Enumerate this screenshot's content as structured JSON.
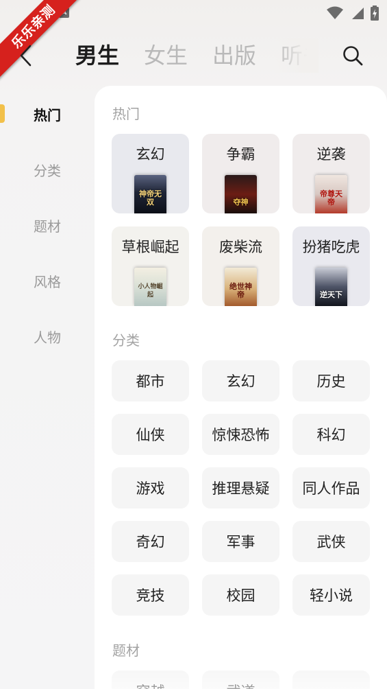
{
  "status": {
    "badge": "A"
  },
  "ribbon": {
    "text": "乐乐亲测"
  },
  "nav": {
    "tabs": [
      {
        "label": "男生",
        "active": true
      },
      {
        "label": "女生",
        "active": false
      },
      {
        "label": "出版",
        "active": false
      },
      {
        "label": "听书",
        "active": false
      }
    ]
  },
  "sidebar": {
    "items": [
      {
        "label": "热门",
        "active": true
      },
      {
        "label": "分类",
        "active": false
      },
      {
        "label": "题材",
        "active": false
      },
      {
        "label": "风格",
        "active": false
      },
      {
        "label": "人物",
        "active": false
      }
    ]
  },
  "hot": {
    "title": "热门",
    "cards": [
      {
        "label": "玄幻",
        "bg": "#e8e9ee",
        "cover_text": "神帝无双"
      },
      {
        "label": "争霸",
        "bg": "#f0ecec",
        "cover_text": "夺神"
      },
      {
        "label": "逆袭",
        "bg": "#f0ecec",
        "cover_text": "帝尊天帝"
      },
      {
        "label": "草根崛起",
        "bg": "#f3f2ee",
        "cover_text": "小人物崛起"
      },
      {
        "label": "废柴流",
        "bg": "#f3f0ec",
        "cover_text": "绝世神帝"
      },
      {
        "label": "扮猪吃虎",
        "bg": "#e9e9ef",
        "cover_text": "逆天下"
      }
    ]
  },
  "category": {
    "title": "分类",
    "items": [
      "都市",
      "玄幻",
      "历史",
      "仙侠",
      "惊悚恐怖",
      "科幻",
      "游戏",
      "推理悬疑",
      "同人作品",
      "奇幻",
      "军事",
      "武侠",
      "竞技",
      "校园",
      "轻小说"
    ]
  },
  "theme": {
    "title": "题材",
    "items": [
      "穿越",
      "武道",
      ""
    ]
  }
}
